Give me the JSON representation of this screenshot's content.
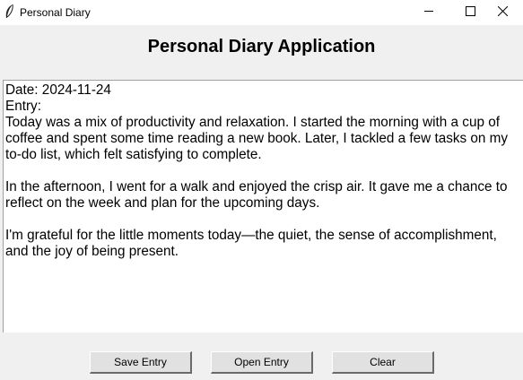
{
  "window": {
    "title": "Personal Diary"
  },
  "header": {
    "title": "Personal Diary Application"
  },
  "editor": {
    "lines": [
      "Date: 2024-11-24",
      "Entry:",
      "Today was a mix of productivity and relaxation. I started the morning with a cup of",
      "coffee and spent some time reading a new book. Later, I tackled a few tasks on my",
      "to-do list, which felt satisfying to complete.",
      "",
      "In the afternoon, I went for a walk and enjoyed the crisp air. It gave me a chance to",
      "reflect on the week and plan for the upcoming days.",
      "",
      "I'm grateful for the little moments today—the quiet, the sense of accomplishment,",
      "and the joy of being present."
    ]
  },
  "buttons": {
    "save_label": "Save Entry",
    "open_label": "Open Entry",
    "clear_label": "Clear"
  },
  "icons": {
    "app": "feather-icon",
    "minimize": "minimize-icon",
    "maximize": "maximize-icon",
    "close": "close-icon"
  }
}
